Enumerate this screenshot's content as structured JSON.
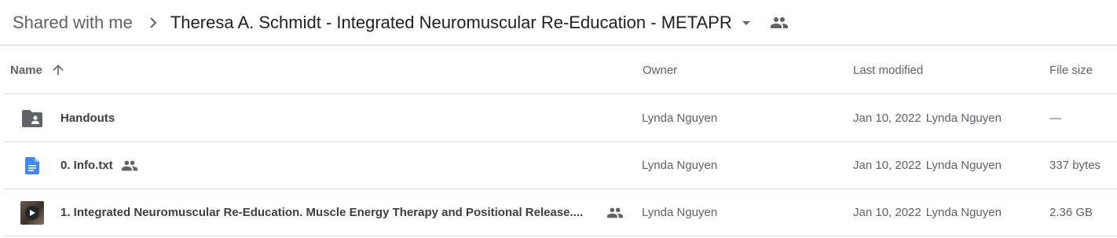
{
  "breadcrumb": {
    "root": "Shared with me",
    "current": "Theresa A. Schmidt - Integrated Neuromuscular Re-Education - METAPR",
    "separator_icon": "chevron-right-icon",
    "dropdown_icon": "caret-down-icon",
    "shared_icon": "people-icon"
  },
  "columns": {
    "name": "Name",
    "sort_icon": "arrow-up-icon",
    "owner": "Owner",
    "last_modified": "Last modified",
    "file_size": "File size"
  },
  "files": [
    {
      "icon": "shared-folder-icon",
      "name": "Handouts",
      "shared": false,
      "owner": "Lynda Nguyen",
      "modified_date": "Jan 10, 2022",
      "modified_by": "Lynda Nguyen",
      "size": "—"
    },
    {
      "icon": "google-doc-icon",
      "name": "0. Info.txt",
      "shared": true,
      "owner": "Lynda Nguyen",
      "modified_date": "Jan 10, 2022",
      "modified_by": "Lynda Nguyen",
      "size": "337 bytes"
    },
    {
      "icon": "video-thumbnail-icon",
      "name": "1. Integrated Neuromuscular Re-Education.  Muscle Energy Therapy and Positional Release....",
      "shared": true,
      "owner": "Lynda Nguyen",
      "modified_date": "Jan 10, 2022",
      "modified_by": "Lynda Nguyen",
      "size": "2.36 GB"
    }
  ],
  "colors": {
    "text_primary": "#202124",
    "text_secondary": "#5f6368",
    "divider": "#dadce0",
    "doc_blue": "#4285f4",
    "folder_gray": "#5f6368"
  }
}
